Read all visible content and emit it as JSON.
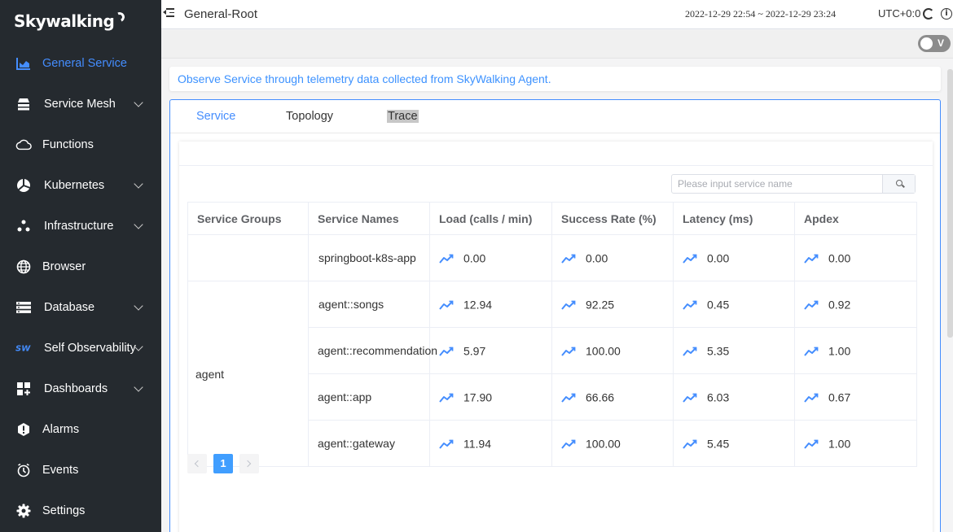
{
  "app": {
    "logo_text": "Skywalking"
  },
  "sidebar": {
    "items": [
      {
        "label": "General Service",
        "icon": "bar-chart-icon",
        "active": true,
        "has_submenu": false
      },
      {
        "label": "Service Mesh",
        "icon": "mesh-icon",
        "active": false,
        "has_submenu": true
      },
      {
        "label": "Functions",
        "icon": "cloud-icon",
        "active": false,
        "has_submenu": false
      },
      {
        "label": "Kubernetes",
        "icon": "kubernetes-icon",
        "active": false,
        "has_submenu": true
      },
      {
        "label": "Infrastructure",
        "icon": "infrastructure-icon",
        "active": false,
        "has_submenu": true
      },
      {
        "label": "Browser",
        "icon": "globe-icon",
        "active": false,
        "has_submenu": false
      },
      {
        "label": "Database",
        "icon": "database-icon",
        "active": false,
        "has_submenu": true
      },
      {
        "label": "Self Observability",
        "icon": "sw-logo-icon",
        "active": false,
        "has_submenu": true
      },
      {
        "label": "Dashboards",
        "icon": "dashboard-icon",
        "active": false,
        "has_submenu": true
      },
      {
        "label": "Alarms",
        "icon": "alarm-icon",
        "active": false,
        "has_submenu": false
      },
      {
        "label": "Events",
        "icon": "events-icon",
        "active": false,
        "has_submenu": false
      },
      {
        "label": "Settings",
        "icon": "gear-icon",
        "active": false,
        "has_submenu": false
      }
    ]
  },
  "header": {
    "title": "General-Root",
    "time_range": "2022-12-29 22:54 ~ 2022-12-29 23:24",
    "timezone": "UTC+0:0",
    "toggle_label": "V"
  },
  "description": "Observe Service through telemetry data collected from SkyWalking Agent.",
  "tabs": [
    "Service",
    "Topology",
    "Trace"
  ],
  "active_tab": "Service",
  "search": {
    "placeholder": "Please input service name",
    "value": ""
  },
  "table": {
    "headers": [
      "Service Groups",
      "Service Names",
      "Load (calls / min)",
      "Success Rate (%)",
      "Latency (ms)",
      "Apdex"
    ],
    "groups": [
      {
        "name": "",
        "rows": [
          {
            "service": "springboot-k8s-app",
            "load": "0.00",
            "success_rate": "0.00",
            "latency": "0.00",
            "apdex": "0.00"
          }
        ]
      },
      {
        "name": "agent",
        "rows": [
          {
            "service": "agent::songs",
            "load": "12.94",
            "success_rate": "92.25",
            "latency": "0.45",
            "apdex": "0.92"
          },
          {
            "service": "agent::recommendation",
            "load": "5.97",
            "success_rate": "100.00",
            "latency": "5.35",
            "apdex": "1.00"
          },
          {
            "service": "agent::app",
            "load": "17.90",
            "success_rate": "66.66",
            "latency": "6.03",
            "apdex": "0.67"
          },
          {
            "service": "agent::gateway",
            "load": "11.94",
            "success_rate": "100.00",
            "latency": "5.45",
            "apdex": "1.00"
          }
        ]
      }
    ]
  },
  "pagination": {
    "current_page": "1"
  },
  "colors": {
    "sidebar_bg": "#252a2f",
    "accent": "#448dfe",
    "link": "#3d92ff"
  }
}
